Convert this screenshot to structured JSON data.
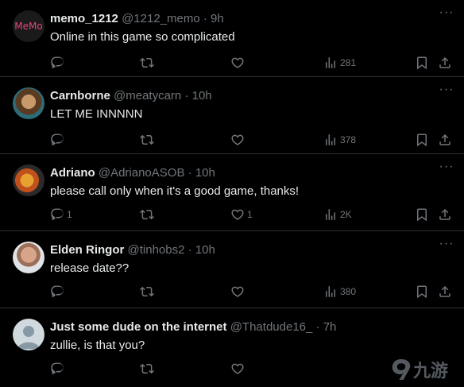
{
  "tweets": [
    {
      "name": "memo_1212",
      "handle": "@1212_memo",
      "time": "9h",
      "text": "Online in this game so complicated",
      "avatar_label": "MeMo",
      "replies": "",
      "likes": "",
      "views": "281"
    },
    {
      "name": "Carnborne",
      "handle": "@meatycarn",
      "time": "10h",
      "text": "LET ME INNNNN",
      "replies": "",
      "likes": "",
      "views": "378"
    },
    {
      "name": "Adriano",
      "handle": "@AdrianoASOB",
      "time": "10h",
      "text": "please call only when it's a good game, thanks!",
      "replies": "1",
      "likes": "1",
      "views": "2K"
    },
    {
      "name": "Elden Ringor",
      "handle": "@tinhobs2",
      "time": "10h",
      "text": "release date??",
      "replies": "",
      "likes": "",
      "views": "380"
    },
    {
      "name": "Just some dude on the internet",
      "handle": "@Thatdude16_",
      "time": "7h",
      "text": "zullie,  is that you?",
      "replies": "",
      "likes": "",
      "views": ""
    }
  ],
  "separator": "·",
  "more_glyph": "···",
  "watermark": {
    "text": "九游"
  },
  "colors": {
    "bg": "#000000",
    "text": "#e7e9ea",
    "muted": "#71767b",
    "border": "#2f3336",
    "memo_text": "#e0457b"
  }
}
